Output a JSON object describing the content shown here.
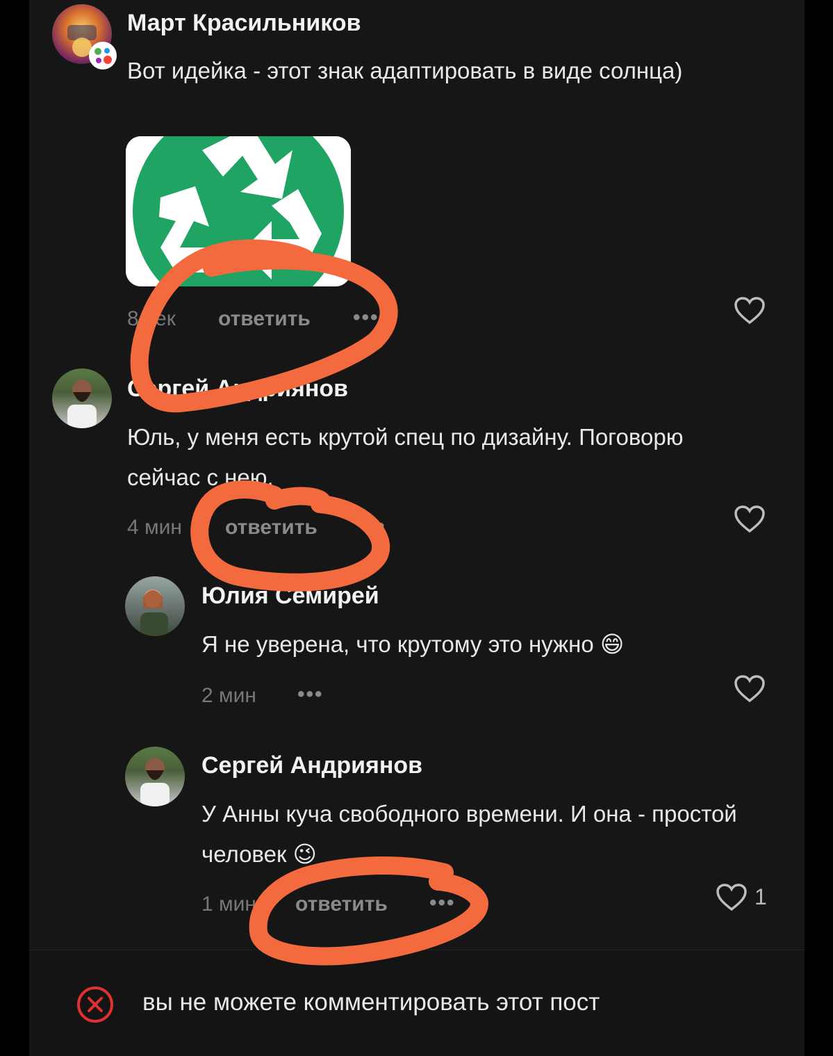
{
  "comments": [
    {
      "author": "Март Красильников",
      "text": "Вот идейка - этот знак адаптировать в виде солнца)",
      "time": "8 сек",
      "reply_label": "ответить",
      "more_label": "•••",
      "attachment": "recycle-symbol-image"
    },
    {
      "author": "Сергей Андриянов",
      "text": "Юль, у меня есть крутой спец по дизайну. Поговорю сейчас с нею.",
      "time": "4 мин",
      "reply_label": "ответить",
      "more_label": "•••"
    },
    {
      "author": "Юлия Семирей",
      "text": "Я не уверена, что крутому это нужно 😄",
      "time": "2 мин",
      "more_label": "•••"
    },
    {
      "author": "Сергей Андриянов",
      "text": "У Анны куча свободного времени. И она - простой человек 😉",
      "time": "1 мин",
      "reply_label": "ответить",
      "more_label": "•••",
      "likes": "1"
    }
  ],
  "footer": {
    "disabled_text": "вы не можете комментировать этот пост",
    "icon": "close-circle-icon"
  },
  "colors": {
    "background": "#161616",
    "annotation": "#f26a3d",
    "recycle_green": "#1fa463",
    "disabled_icon": "#e03131"
  }
}
